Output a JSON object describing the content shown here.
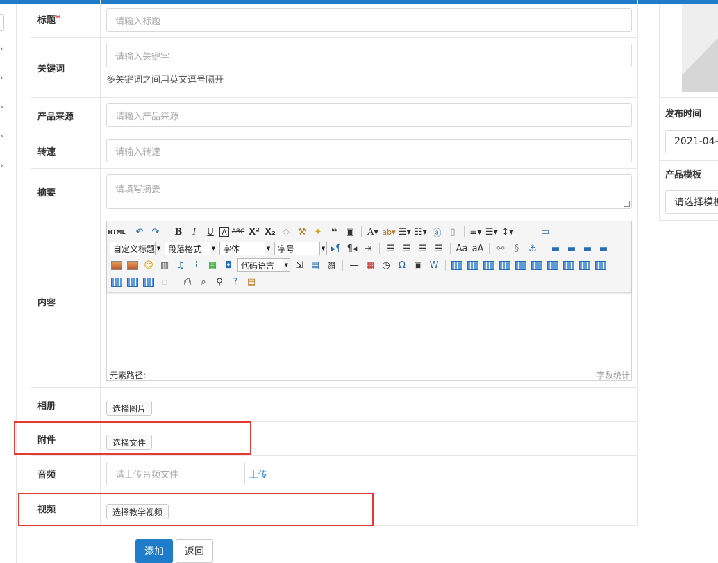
{
  "form": {
    "title_label": "标题",
    "title_required": "*",
    "title_placeholder": "请输入标题",
    "keywords_label": "关键词",
    "keywords_placeholder": "请输入关键字",
    "keywords_help": "多关键词之间用英文逗号隔开",
    "source_label": "产品来源",
    "source_placeholder": "请输入产品来源",
    "speed_label": "转速",
    "speed_placeholder": "请输入转速",
    "summary_label": "摘要",
    "summary_placeholder": "请填写摘要",
    "content_label": "内容",
    "album_label": "相册",
    "album_button": "选择图片",
    "attachment_label": "附件",
    "attachment_button": "选择文件",
    "audio_label": "音频",
    "audio_placeholder": "请上传音频文件",
    "audio_upload": "上传",
    "video_label": "视频",
    "video_button": "选择教学视频"
  },
  "editor": {
    "html_label": "HTML",
    "custom_title": "自定义标题",
    "paragraph": "段落格式",
    "font": "字体",
    "font_size": "字号",
    "code_language": "代码语言",
    "element_path": "元素路径:",
    "word_count": "字数统计",
    "icons": [
      "undo-icon",
      "redo-icon",
      "bold-icon",
      "italic-icon",
      "underline-icon",
      "font-border-icon",
      "strikethrough-icon",
      "superscript-icon",
      "subscript-icon",
      "eraser-icon",
      "format-brush-icon",
      "magic-icon",
      "quote-icon",
      "paste-text-icon",
      "font-color-icon",
      "highlight-icon",
      "ordered-list-icon",
      "unordered-list-icon",
      "select-all-icon",
      "clear-doc-icon",
      "row-spacing-icon",
      "paragraph-spacing-icon",
      "line-height-icon",
      "fullscreen-icon"
    ]
  },
  "actions": {
    "add": "添加",
    "back": "返回"
  },
  "side": {
    "publish_label": "发布时间",
    "publish_value": "2021-04-",
    "template_label": "产品模板",
    "template_value": "请选择模板"
  },
  "colors": {
    "primary": "#1E7CC8",
    "highlight": "#e53935"
  }
}
